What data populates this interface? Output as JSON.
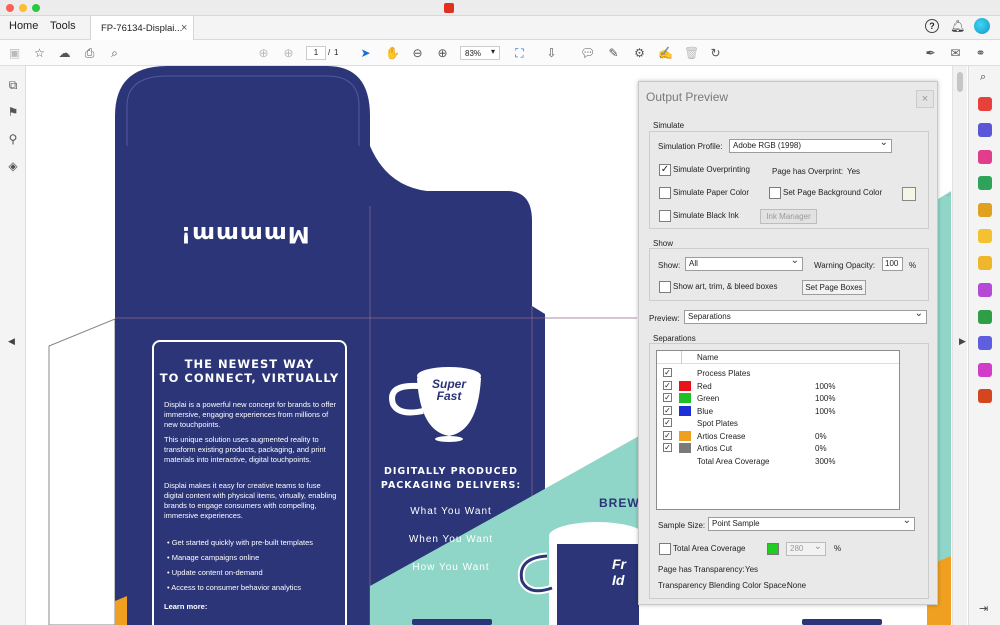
{
  "window": {
    "title_icon": "acrobat-icon"
  },
  "tabs": {
    "home": "Home",
    "tools": "Tools",
    "document": "FP-76134-Displai...",
    "close": "×"
  },
  "toolbar": {
    "page_current": "1",
    "page_sep": "/",
    "page_total": "1",
    "zoom": "83%"
  },
  "document": {
    "lid_text": "Mmmmm!",
    "panel_heading": "THE NEWEST WAY\nTO CONNECT, VIRTUALLY",
    "para1": "Displai is a powerful new concept for brands to offer immersive, engaging experiences from millions of new touchpoints.",
    "para2": "This unique solution uses augmented reality to transform existing products, packaging, and print materials into interactive, digital touchpoints.",
    "para3": "Displai makes it easy for creative teams to fuse digital content with physical items, virtually, enabling brands to engage consumers with compelling, immersive experiences.",
    "bullets": [
      "Get started quickly with pre-built templates",
      "Manage campaigns online",
      "Update content on-demand",
      "Access to consumer behavior analytics"
    ],
    "learn_more": "Learn more:",
    "logo_line1": "Super",
    "logo_line2": "Fast",
    "tagline": "DIGITALLY PRODUCED\nPACKAGING DELIVERS:",
    "line1": "What You Want",
    "line2": "When You Want",
    "line3": "How You Want",
    "side_brew": "BREW",
    "side_cup": "Fr\nId"
  },
  "output_preview": {
    "title": "Output Preview",
    "simulate_group": "Simulate",
    "simulation_profile_label": "Simulation Profile:",
    "simulation_profile_value": "Adobe RGB (1998)",
    "simulate_overprinting": "Simulate Overprinting",
    "simulate_overprinting_checked": true,
    "page_has_overprint_label": "Page has Overprint:",
    "page_has_overprint_value": "Yes",
    "simulate_paper_color": "Simulate Paper Color",
    "set_page_background_color": "Set Page Background Color",
    "simulate_black_ink": "Simulate Black Ink",
    "ink_manager": "Ink Manager",
    "show_group": "Show",
    "show_label": "Show:",
    "show_value": "All",
    "warning_opacity_label": "Warning Opacity:",
    "warning_opacity_value": "100",
    "percent": "%",
    "show_art_trim": "Show art, trim, & bleed boxes",
    "set_page_boxes": "Set Page Boxes",
    "preview_label": "Preview:",
    "preview_value": "Separations",
    "separations_group": "Separations",
    "table_header_name": "Name",
    "rows": [
      {
        "name": "Process Plates",
        "value": "",
        "checked": true,
        "color": ""
      },
      {
        "name": "Red",
        "value": "100%",
        "checked": true,
        "color": "#e8141a"
      },
      {
        "name": "Green",
        "value": "100%",
        "checked": true,
        "color": "#1fbf26"
      },
      {
        "name": "Blue",
        "value": "100%",
        "checked": true,
        "color": "#1f2fd6"
      },
      {
        "name": "Spot Plates",
        "value": "",
        "checked": true,
        "color": ""
      },
      {
        "name": "Artios Crease",
        "value": "0%",
        "checked": true,
        "color": "#f0a020"
      },
      {
        "name": "Artios Cut",
        "value": "0%",
        "checked": true,
        "color": "#7a7a7a"
      },
      {
        "name": "Total Area Coverage",
        "value": "300%",
        "checked": false,
        "color": ""
      }
    ],
    "sample_size_label": "Sample Size:",
    "sample_size_value": "Point Sample",
    "total_area_coverage": "Total Area Coverage",
    "tac_value": "280",
    "tac_color": "#22cc22",
    "page_has_transparency_label": "Page has Transparency:",
    "page_has_transparency_value": "Yes",
    "blending_label": "Transparency Blending Color Space:",
    "blending_value": "None"
  },
  "colors": {
    "navy": "#2b3578",
    "mint": "#8fd6c8",
    "accent_blue": "#1a6fd8"
  }
}
